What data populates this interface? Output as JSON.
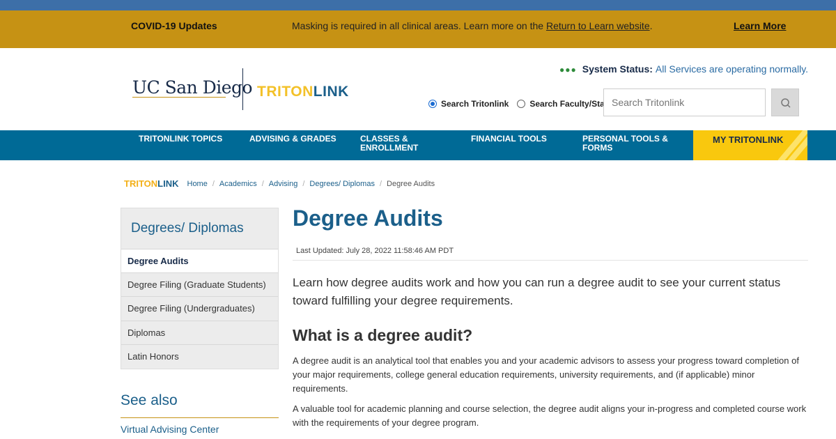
{
  "alert": {
    "title": "COVID-19 Updates",
    "message_pre": "Masking is required in all clinical areas. Learn more on the ",
    "message_link": "Return to Learn website",
    "message_post": ".",
    "learn_more": "Learn More",
    "color": "#c69214"
  },
  "header": {
    "logo_ucsd": "UC San Diego",
    "logo_triton_1": "TRITON",
    "logo_triton_2": "LINK",
    "system_status_dots": "●●●",
    "system_status_label": "System Status:",
    "system_status_text": "All Services are operating normally.",
    "radio_tritonlink": "Search Tritonlink",
    "radio_faculty": "Search Faculty/Staff",
    "search_placeholder": "Search Tritonlink"
  },
  "nav": {
    "items": [
      {
        "label1": "TRITONLINK TOPICS",
        "label2": ""
      },
      {
        "label1": "ADVISING & GRADES",
        "label2": ""
      },
      {
        "label1": "CLASSES &",
        "label2": "ENROLLMENT"
      },
      {
        "label1": "FINANCIAL TOOLS",
        "label2": ""
      },
      {
        "label1": "PERSONAL TOOLS &",
        "label2": "FORMS"
      }
    ],
    "my_tritonlink": "MY TRITONLINK",
    "color": "#006a96",
    "accent": "#f9c80e"
  },
  "breadcrumb": {
    "brand_1": "TRITON",
    "brand_2": "LINK",
    "items": [
      "Home",
      "Academics",
      "Advising",
      "Degrees/ Diplomas"
    ],
    "current": "Degree Audits"
  },
  "sidebar": {
    "title": "Degrees/ Diplomas",
    "items": [
      "Degree Audits",
      "Degree Filing (Graduate Students)",
      "Degree Filing (Undergraduates)",
      "Diplomas",
      "Latin Honors"
    ],
    "see_also": "See also",
    "see_also_link": "Virtual Advising Center"
  },
  "main": {
    "title": "Degree Audits",
    "updated": "Last Updated: July 28, 2022 11:58:46 AM PDT",
    "lead": "Learn how degree audits work and how you can run a degree audit to see your current status toward fulfilling your degree requirements.",
    "h2": "What is a degree audit?",
    "p1": "A degree audit is an analytical tool that enables you and your academic advisors to assess your progress toward completion of your major requirements, college general education requirements, university requirements, and (if applicable) minor requirements.",
    "p2": "A valuable tool for academic planning and course selection, the degree audit aligns your in-progress and completed course work with the requirements of your degree program."
  }
}
